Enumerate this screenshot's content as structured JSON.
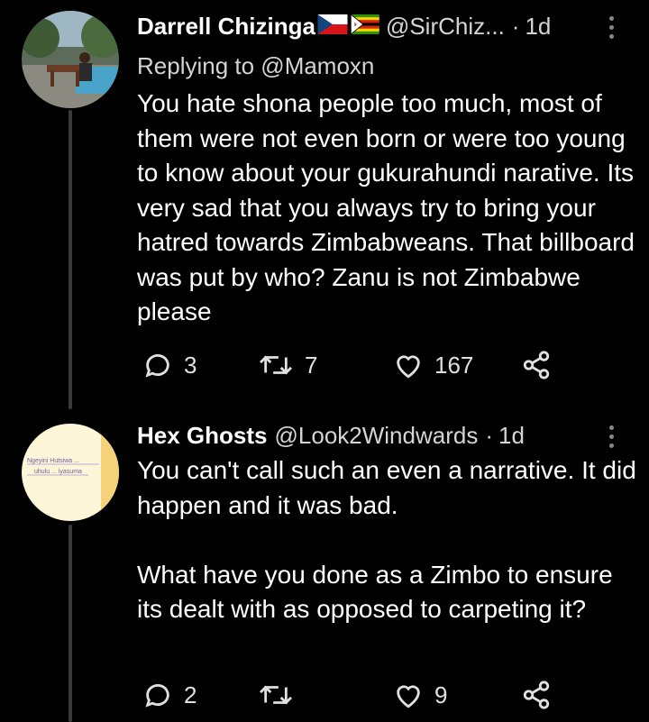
{
  "tweets": [
    {
      "name": "Darrell Chizinga",
      "flags": [
        "czech-flag",
        "zimbabwe-flag"
      ],
      "handle": "@SirChiz...",
      "time": "1d",
      "replying_to": "Replying to @Mamoxn",
      "text": "You hate shona people too much, most of them were not even born or were too young to know about your gukurahundi narative. Its very sad that you always try to bring your hatred towards Zimbabweans. That billboard was put by who? Zanu is not Zimbabwe please",
      "replies": "3",
      "retweets": "7",
      "likes": "167"
    },
    {
      "name": "Hex Ghosts",
      "handle": "@Look2Windwards",
      "time": "1d",
      "text": "You can't call such an even a narrative. It did happen and it was bad.\n\nWhat have you done as a Zimbo to ensure its dealt with as opposed to carpeting it?",
      "replies": "2",
      "retweets": "",
      "likes": "9"
    }
  ],
  "separator": "·",
  "colors": {
    "background": "#000000",
    "text": "#ffffff",
    "secondary": "#d4d4d4",
    "thread_line": "#3a3a3a"
  }
}
